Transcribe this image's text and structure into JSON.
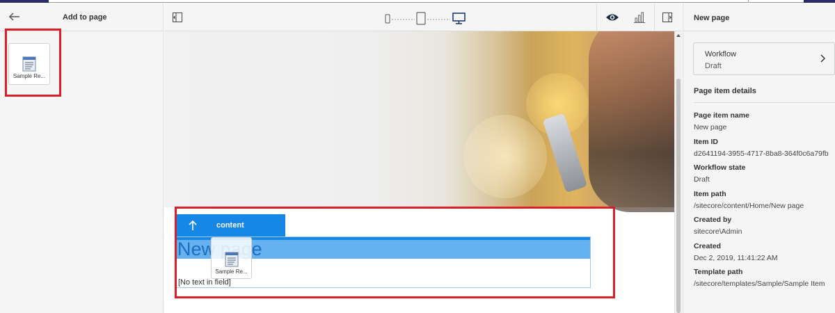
{
  "left_panel": {
    "title": "Add to page",
    "components": [
      {
        "label": "Sample Re..."
      }
    ]
  },
  "canvas": {
    "placeholder_name": "content",
    "page_heading": "New page",
    "empty_field_text": "[No text in field]",
    "drag_ghost_label": "Sample Re..."
  },
  "icons": {
    "back": "arrow-left-icon",
    "toggle_left": "toggle-left-panel-icon",
    "devices": [
      "mobile-icon",
      "tablet-icon",
      "desktop-icon"
    ],
    "preview": "eye-icon",
    "analytics": "bar-chart-icon",
    "toggle_right": "toggle-right-panel-icon"
  },
  "right_panel": {
    "title": "New page",
    "workflow": {
      "title": "Workflow",
      "state": "Draft"
    },
    "section_title": "Page item details",
    "details": [
      {
        "label": "Page item name",
        "value": "New page"
      },
      {
        "label": "Item ID",
        "value": "d2641194-3955-4717-8ba8-364f0c6a79fb"
      },
      {
        "label": "Workflow state",
        "value": "Draft"
      },
      {
        "label": "Item path",
        "value": "/sitecore/content/Home/New page"
      },
      {
        "label": "Created by",
        "value": "sitecore\\Admin"
      },
      {
        "label": "Created",
        "value": "Dec 2, 2019, 11:41:22 AM"
      },
      {
        "label": "Template path",
        "value": "/sitecore/templates/Sample/Sample Item"
      }
    ]
  },
  "colors": {
    "accent": "#1787e6",
    "highlight": "#66b2f0",
    "annotation": "#d9202a"
  }
}
